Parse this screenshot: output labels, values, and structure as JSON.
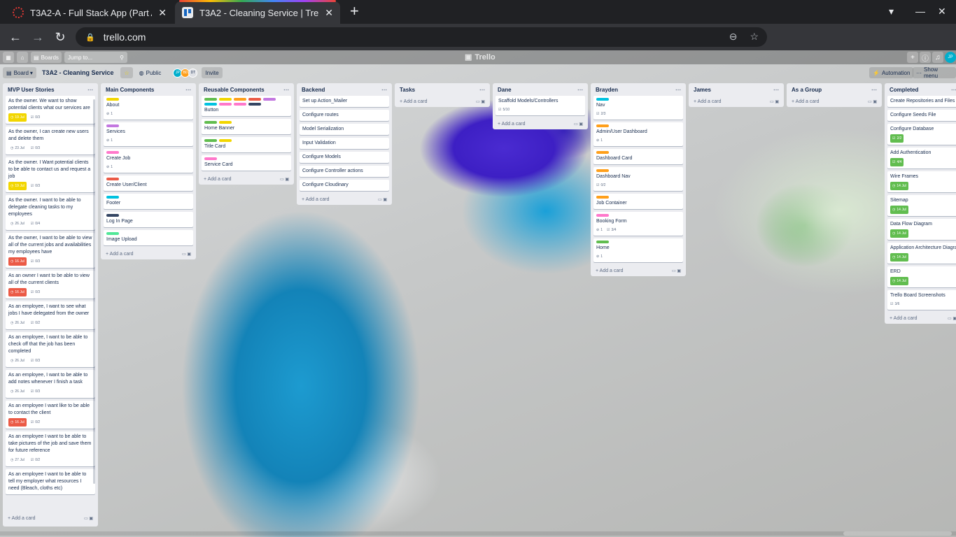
{
  "browser": {
    "tabs": [
      {
        "title": "T3A2-A - Full Stack App (Part A",
        "close": "✕"
      },
      {
        "title": "T3A2 - Cleaning Service | Trello",
        "close": "✕"
      }
    ],
    "new_tab": "+",
    "url": "trello.com"
  },
  "trello": {
    "boards_label": "Boards",
    "jump_placeholder": "Jump to...",
    "logo": "Trello",
    "board_view": "Board",
    "board_title": "T3A2 - Cleaning Service",
    "visibility": "Public",
    "members": [
      "JP",
      "BD",
      "DT"
    ],
    "invite": "Invite",
    "automation": "Automation",
    "show_menu": "Show menu",
    "add_card": "Add a card"
  },
  "lists": [
    {
      "title": "MVP User Stories",
      "cards": [
        {
          "text": "As the owner. We want to show potential clients what our services are",
          "badges": [
            {
              "kind": "due",
              "style": "yellow",
              "text": "19 Jul"
            },
            {
              "kind": "chk",
              "text": "0/3"
            }
          ]
        },
        {
          "text": "As the owner, I can create new users and delete them",
          "badges": [
            {
              "kind": "due",
              "style": "plain",
              "text": "23 Jul"
            },
            {
              "kind": "chk",
              "text": "0/3"
            }
          ]
        },
        {
          "text": "As the owner. I Want potential clients to be able to contact us and request a job",
          "badges": [
            {
              "kind": "due",
              "style": "yellow",
              "text": "19 Jul"
            },
            {
              "kind": "chk",
              "text": "0/3"
            }
          ]
        },
        {
          "text": "As the owner. I want to be able to delegate cleaning tasks to my employees",
          "badges": [
            {
              "kind": "due",
              "style": "plain",
              "text": "26 Jul"
            },
            {
              "kind": "chk",
              "text": "0/4"
            }
          ]
        },
        {
          "text": "As the owner, I want to be able to view all of the current jobs and availabilities my employees have",
          "badges": [
            {
              "kind": "due",
              "style": "red",
              "text": "16 Jul"
            },
            {
              "kind": "chk",
              "text": "0/3"
            }
          ]
        },
        {
          "text": "As an owner I want to be able to view all of the current clients",
          "badges": [
            {
              "kind": "due",
              "style": "red",
              "text": "16 Jul"
            },
            {
              "kind": "chk",
              "text": "0/3"
            }
          ]
        },
        {
          "text": "As an employee, I want to see what jobs I have delegated from the owner",
          "badges": [
            {
              "kind": "due",
              "style": "plain",
              "text": "26 Jul"
            },
            {
              "kind": "chk",
              "text": "0/2"
            }
          ]
        },
        {
          "text": "As an employee, I want to be able to check off that the job has been completed",
          "badges": [
            {
              "kind": "due",
              "style": "plain",
              "text": "26 Jul"
            },
            {
              "kind": "chk",
              "text": "0/3"
            }
          ]
        },
        {
          "text": "As an employee, I want to be able to add notes whenever I finish a task",
          "badges": [
            {
              "kind": "due",
              "style": "plain",
              "text": "26 Jul"
            },
            {
              "kind": "chk",
              "text": "0/3"
            }
          ]
        },
        {
          "text": "As an employee I want like to be able to contact the client",
          "badges": [
            {
              "kind": "due",
              "style": "red",
              "text": "16 Jul"
            },
            {
              "kind": "chk",
              "text": "0/2"
            }
          ]
        },
        {
          "text": "As an employee I want to be able to take pictures of the job and save them for future reference",
          "badges": [
            {
              "kind": "due",
              "style": "plain",
              "text": "27 Jul"
            },
            {
              "kind": "chk",
              "text": "0/2"
            }
          ]
        },
        {
          "text": "As an employee I want to be able to tell my employer what resources I need (Bleach, cloths etc)",
          "badges": []
        }
      ]
    },
    {
      "title": "Main Components",
      "cards": [
        {
          "text": "About",
          "labels": [
            "#f2d600"
          ],
          "badges": [
            {
              "kind": "att",
              "text": "1"
            }
          ]
        },
        {
          "text": "Services",
          "labels": [
            "#c377e0"
          ],
          "badges": [
            {
              "kind": "att",
              "text": "1"
            }
          ]
        },
        {
          "text": "Create Job",
          "labels": [
            "#ff78cb"
          ],
          "badges": [
            {
              "kind": "att",
              "text": "1"
            }
          ]
        },
        {
          "text": "Create User/Client",
          "labels": [
            "#eb5a46"
          ],
          "badges": []
        },
        {
          "text": "Footer",
          "labels": [
            "#00c2e0"
          ],
          "badges": []
        },
        {
          "text": "Log In Page",
          "labels": [
            "#344563"
          ],
          "badges": []
        },
        {
          "text": "Image Upload",
          "labels": [
            "#51e898"
          ],
          "badges": []
        }
      ]
    },
    {
      "title": "Reusable Components",
      "cards": [
        {
          "text": "Button",
          "labels": [
            "#61bd4f",
            "#f2d600",
            "#ff9f1a",
            "#eb5a46",
            "#c377e0",
            "#00c2e0",
            "#ff78cb",
            "#ff78cb",
            "#344563"
          ],
          "badges": []
        },
        {
          "text": "Home Banner",
          "labels": [
            "#61bd4f",
            "#f2d600"
          ],
          "badges": []
        },
        {
          "text": "Title Card",
          "labels": [
            "#61bd4f",
            "#f2d600"
          ],
          "badges": []
        },
        {
          "text": "Service Card",
          "labels": [
            "#ff78cb"
          ],
          "badges": []
        }
      ]
    },
    {
      "title": "Backend",
      "cards": [
        {
          "text": "Set up Action_Mailer",
          "badges": []
        },
        {
          "text": "Configure routes",
          "badges": []
        },
        {
          "text": "Model Serialization",
          "badges": []
        },
        {
          "text": "Input Validation",
          "badges": []
        },
        {
          "text": "Configure Models",
          "badges": []
        },
        {
          "text": "Configure Controller actions",
          "badges": []
        },
        {
          "text": "Configure Cloudinary",
          "badges": []
        }
      ]
    },
    {
      "title": "Tasks",
      "cards": []
    },
    {
      "title": "Dane",
      "cards": [
        {
          "text": "Scaffold Models/Controllers",
          "badges": [
            {
              "kind": "chk",
              "text": "5/10"
            }
          ]
        }
      ]
    },
    {
      "title": "Brayden",
      "cards": [
        {
          "text": "Nav",
          "labels": [
            "#00c2e0"
          ],
          "badges": [
            {
              "kind": "chk",
              "text": "2/3"
            }
          ]
        },
        {
          "text": "Admin/User Dashboard",
          "labels": [
            "#ff9f1a"
          ],
          "badges": [
            {
              "kind": "att",
              "text": "1"
            }
          ]
        },
        {
          "text": "Dashboard Card",
          "labels": [
            "#ff9f1a"
          ],
          "badges": []
        },
        {
          "text": "Dashboard Nav",
          "labels": [
            "#ff9f1a"
          ],
          "badges": [
            {
              "kind": "chk",
              "text": "0/2"
            }
          ]
        },
        {
          "text": "Job Container",
          "labels": [
            "#ff9f1a"
          ],
          "badges": []
        },
        {
          "text": "Booking Form",
          "labels": [
            "#ff78cb"
          ],
          "badges": [
            {
              "kind": "att",
              "text": "1"
            },
            {
              "kind": "chk",
              "text": "3/4"
            }
          ]
        },
        {
          "text": "Home",
          "labels": [
            "#61bd4f"
          ],
          "badges": [
            {
              "kind": "att",
              "text": "1"
            }
          ]
        }
      ]
    },
    {
      "title": "James",
      "cards": []
    },
    {
      "title": "As a Group",
      "cards": []
    },
    {
      "title": "Completed",
      "cards": [
        {
          "text": "Create Repositories and Files",
          "badges": []
        },
        {
          "text": "Configure Seeds File",
          "badges": []
        },
        {
          "text": "Configure Database",
          "badges": [
            {
              "kind": "chk",
              "style": "green",
              "text": "2/2"
            }
          ]
        },
        {
          "text": "Add Authentication",
          "badges": [
            {
              "kind": "chk",
              "style": "green",
              "text": "4/4"
            }
          ]
        },
        {
          "text": "Wire Frames",
          "badges": [
            {
              "kind": "due",
              "style": "green",
              "text": "14 Jul"
            }
          ]
        },
        {
          "text": "Sitemap",
          "badges": [
            {
              "kind": "due",
              "style": "green",
              "text": "14 Jul"
            }
          ]
        },
        {
          "text": "Data Flow Diagram",
          "badges": [
            {
              "kind": "due",
              "style": "green",
              "text": "14 Jul"
            }
          ]
        },
        {
          "text": "Application Architecture Diagram",
          "badges": [
            {
              "kind": "due",
              "style": "green",
              "text": "14 Jul"
            }
          ]
        },
        {
          "text": "ERD",
          "badges": [
            {
              "kind": "due",
              "style": "green",
              "text": "14 Jul"
            }
          ]
        },
        {
          "text": "Trello Board Screenshots",
          "badges": [
            {
              "kind": "chk",
              "text": "3/6"
            }
          ]
        }
      ]
    }
  ]
}
